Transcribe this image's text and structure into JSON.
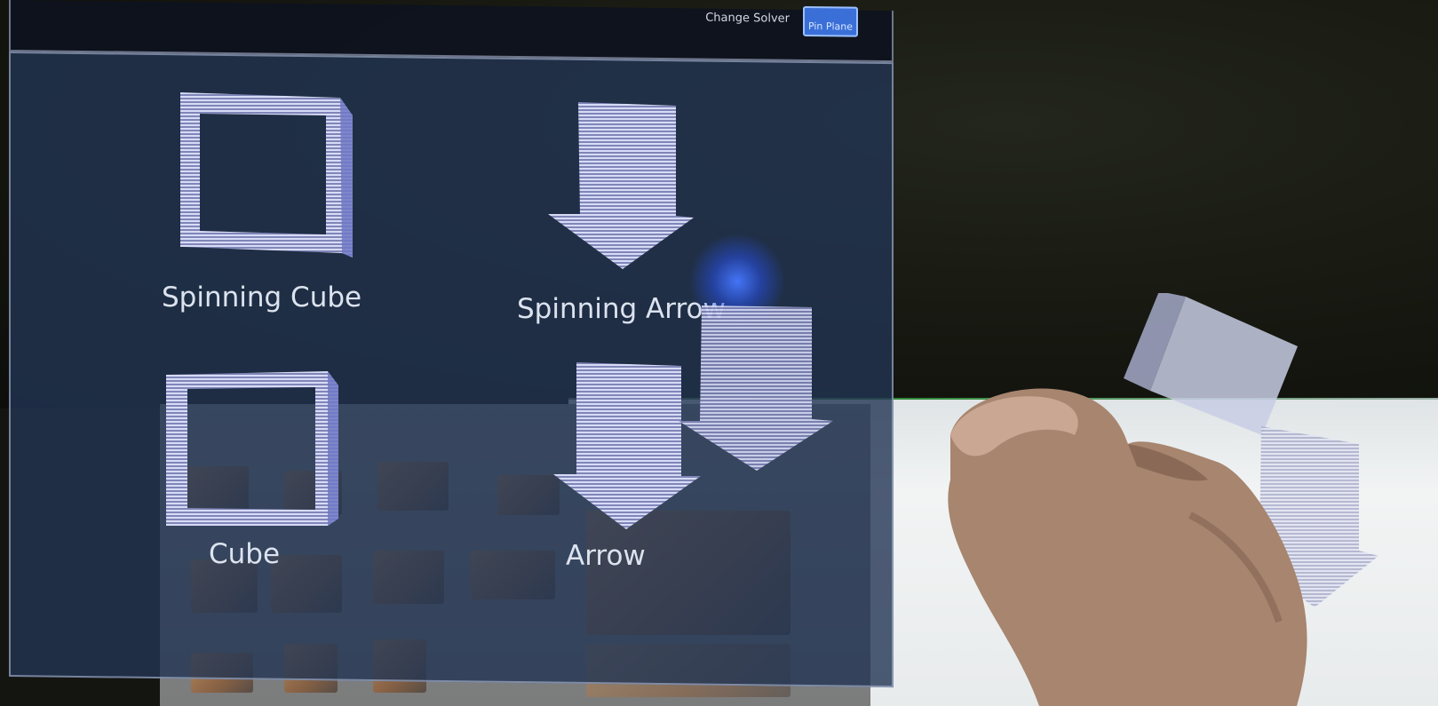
{
  "toolbar": {
    "change_solver_label": "Change Solver",
    "pin_button_label": "Pin Plane"
  },
  "tiles": [
    {
      "label": "Spinning Cube",
      "icon": "cube-icon"
    },
    {
      "label": "Spinning Arrow",
      "icon": "arrow-down-icon"
    },
    {
      "label": "Cube",
      "icon": "cube-icon"
    },
    {
      "label": "Arrow",
      "icon": "arrow-down-icon"
    }
  ],
  "colors": {
    "panel": "#22344f",
    "accent": "#3a6fd8",
    "hologram": "#c9ccf0",
    "cursor": "#4a78ff"
  }
}
